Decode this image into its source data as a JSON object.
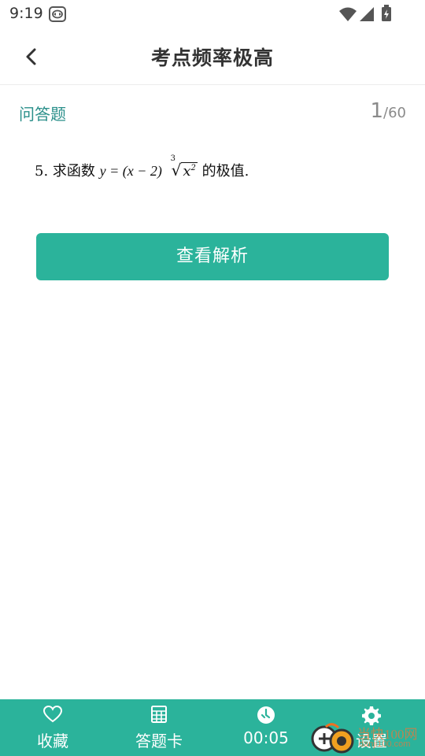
{
  "status_bar": {
    "time": "9:19",
    "icons": [
      "app-remote-icon",
      "wifi-icon",
      "signal-icon",
      "battery-charging-icon"
    ]
  },
  "header": {
    "title": "考点频率极高",
    "back_icon": "chevron-left-icon"
  },
  "question": {
    "type": "问答题",
    "current": "1",
    "separator": "/",
    "total": "60",
    "text_prefix": "5. 求函数 ",
    "text_math": "y = (x − 2)",
    "radical_index": "3",
    "radical_base": "x",
    "radical_exp": "2",
    "text_suffix": " 的极值."
  },
  "analysis_button": {
    "label": "查看解析"
  },
  "bottom_bar": {
    "favorite": {
      "label": "收藏",
      "icon": "heart-icon"
    },
    "answer_card": {
      "label": "答题卡",
      "icon": "grid-icon"
    },
    "timer": {
      "label": "00:05",
      "icon": "clock-icon"
    },
    "settings": {
      "label": "设置",
      "icon": "gear-icon"
    }
  },
  "watermark": {
    "text": "当快100网",
    "subtext": "danji100.com"
  },
  "colors": {
    "accent": "#2bb39b",
    "question_type": "#2a8f8a",
    "counter": "#8a8a8a"
  }
}
